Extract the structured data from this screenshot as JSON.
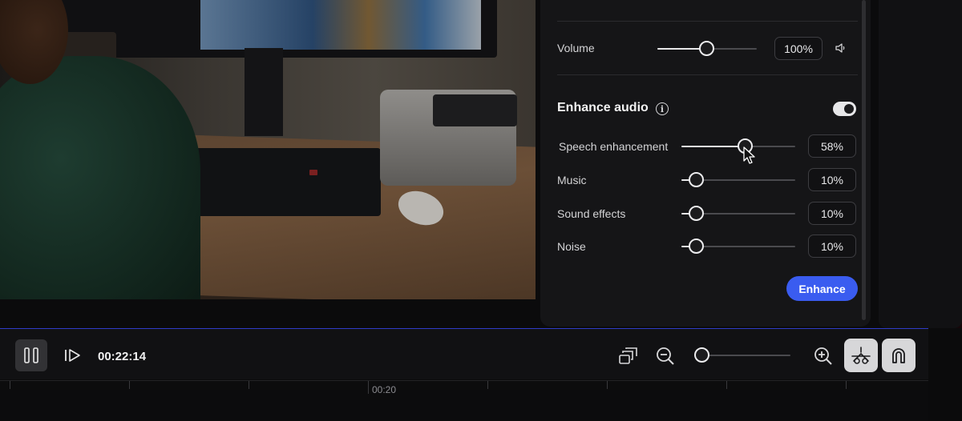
{
  "panel": {
    "volume": {
      "label": "Volume",
      "value": "100%",
      "level": 0.5
    },
    "enhance": {
      "title": "Enhance audio",
      "enabled": true,
      "sliders": [
        {
          "label": "Speech enhancement",
          "value": "58%",
          "level": 0.58
        },
        {
          "label": "Music",
          "value": "10%",
          "level": 0.1
        },
        {
          "label": "Sound effects",
          "value": "10%",
          "level": 0.1
        },
        {
          "label": "Noise",
          "value": "10%",
          "level": 0.1
        }
      ],
      "button_label": "Enhance"
    }
  },
  "transport": {
    "timecode": "00:22:14",
    "zoom_level": 0.1
  },
  "timeline": {
    "marker_label": "00:20"
  },
  "colors": {
    "accent": "#3a5cf0",
    "timeline_border": "#2f3cc8"
  },
  "icons": [
    "pause-icon",
    "step-forward-icon",
    "fit-to-screen-icon",
    "zoom-out-icon",
    "zoom-in-icon",
    "volume-icon",
    "info-icon",
    "scissors-icon",
    "magnet-icon",
    "mouse-pointer-icon"
  ]
}
